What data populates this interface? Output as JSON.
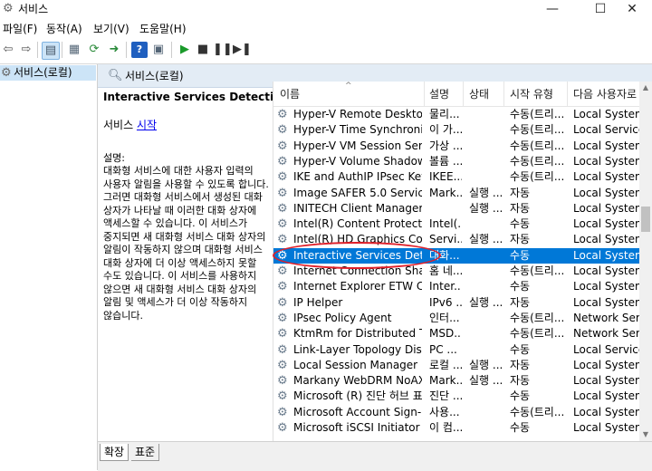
{
  "window": {
    "title": "서비스",
    "minimize_glyph": "—",
    "maximize_glyph": "☐",
    "close_glyph": "✕"
  },
  "menu": [
    {
      "label": "파일(F)"
    },
    {
      "label": "동작(A)"
    },
    {
      "label": "보기(V)"
    },
    {
      "label": "도움말(H)"
    }
  ],
  "tree": {
    "label": "서비스(로컬)",
    "icon": "gear-icon"
  },
  "main_header": {
    "label": "서비스(로컬)"
  },
  "description": {
    "title": "Interactive Services Detection",
    "service_prefix": "서비스 ",
    "start_link": "시작",
    "heading": "설명:",
    "body": "대화형 서비스에 대한 사용자 입력의 사용자 알림을 사용할 수 있도록 합니다. 그러면 대화형 서비스에서 생성된 대화 상자가 나타날 때 이러한 대화 상자에 액세스할 수 있습니다. 이 서비스가 중지되면 새 대화형 서비스 대화 상자의 알림이 작동하지 않으며 대화형 서비스 대화 상자에 더 이상 액세스하지 못할 수도 있습니다. 이 서비스를 사용하지 않으면 새 대화형 서비스 대화 상자의 알림 및 액세스가 더 이상 작동하지 않습니다."
  },
  "list": {
    "sort_arrow": "^",
    "columns": [
      "이름",
      "설명",
      "상태",
      "시작 유형",
      "다음 사용자로 로"
    ],
    "rows": [
      {
        "name": "Hyper-V Remote Desktop ...",
        "desc": "물리...",
        "status": "",
        "startup": "수동(트리...",
        "logon": "Local System"
      },
      {
        "name": "Hyper-V Time Synchroniza...",
        "desc": "이 가...",
        "status": "",
        "startup": "수동(트리...",
        "logon": "Local Service"
      },
      {
        "name": "Hyper-V VM Session Service",
        "desc": "가상 ...",
        "status": "",
        "startup": "수동(트리...",
        "logon": "Local System"
      },
      {
        "name": "Hyper-V Volume Shadow ...",
        "desc": "볼륨 ...",
        "status": "",
        "startup": "수동(트리...",
        "logon": "Local System"
      },
      {
        "name": "IKE and AuthIP IPsec Keyin...",
        "desc": "IKEE...",
        "status": "",
        "startup": "수동(트리...",
        "logon": "Local System"
      },
      {
        "name": "Image SAFER 5.0 Service",
        "desc": "Mark...",
        "status": "실행 ...",
        "startup": "자동",
        "logon": "Local System"
      },
      {
        "name": "INITECH Client Manager Se...",
        "desc": "",
        "status": "실행 ...",
        "startup": "자동",
        "logon": "Local System"
      },
      {
        "name": "Intel(R) Content Protection...",
        "desc": "Intel(...",
        "status": "",
        "startup": "수동",
        "logon": "Local System"
      },
      {
        "name": "Intel(R) HD Graphics Contr...",
        "desc": "Servi...",
        "status": "실행 ...",
        "startup": "자동",
        "logon": "Local System"
      },
      {
        "name": "Interactive Services Detecti...",
        "desc": "대화...",
        "status": "",
        "startup": "수동",
        "logon": "Local System",
        "selected": true
      },
      {
        "name": "Internet Connection Sharin...",
        "desc": "홈 네...",
        "status": "",
        "startup": "수동(트리...",
        "logon": "Local System"
      },
      {
        "name": "Internet Explorer ETW Colle...",
        "desc": "Inter...",
        "status": "",
        "startup": "수동",
        "logon": "Local System"
      },
      {
        "name": "IP Helper",
        "desc": "IPv6 ...",
        "status": "실행 ...",
        "startup": "자동",
        "logon": "Local System"
      },
      {
        "name": "IPsec Policy Agent",
        "desc": "인터...",
        "status": "",
        "startup": "수동(트리...",
        "logon": "Network Service"
      },
      {
        "name": "KtmRm for Distributed Tra...",
        "desc": "MSD...",
        "status": "",
        "startup": "수동(트리...",
        "logon": "Network Service"
      },
      {
        "name": "Link-Layer Topology Disco...",
        "desc": "PC ...",
        "status": "",
        "startup": "수동",
        "logon": "Local Service"
      },
      {
        "name": "Local Session Manager",
        "desc": "로컬 ...",
        "status": "실행 ...",
        "startup": "자동",
        "logon": "Local System"
      },
      {
        "name": "Markany WebDRM NoAX",
        "desc": "Mark...",
        "status": "실행 ...",
        "startup": "자동",
        "logon": "Local System"
      },
      {
        "name": "Microsoft (R) 진단 허브 표...",
        "desc": "진단 ...",
        "status": "",
        "startup": "수동",
        "logon": "Local System"
      },
      {
        "name": "Microsoft Account Sign-in ...",
        "desc": "사용...",
        "status": "",
        "startup": "수동(트리...",
        "logon": "Local System"
      },
      {
        "name": "Microsoft iSCSI Initiator Se...",
        "desc": "이 컴...",
        "status": "",
        "startup": "수동",
        "logon": "Local System"
      }
    ]
  },
  "tabs": [
    {
      "label": "확장"
    },
    {
      "label": "표준"
    }
  ],
  "colors": {
    "selection": "#0078d7",
    "annotation": "#e0202a",
    "header_bg": "#e3ecf5",
    "link": "#0000ee"
  }
}
